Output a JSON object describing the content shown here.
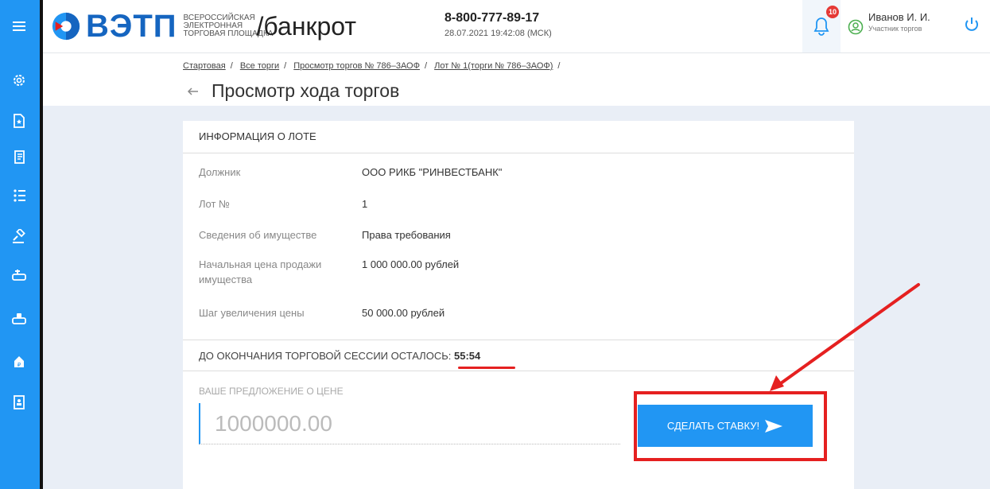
{
  "brand": {
    "logo_text": "ВЭТП",
    "sub_line1": "ВСЕРОССИЙСКАЯ",
    "sub_line2": "ЭЛЕКТРОННАЯ",
    "sub_line3": "ТОРГОВАЯ ПЛОЩАДКА",
    "section": "/банкрот",
    "colors": {
      "primary": "#2196f3",
      "brand": "#1565c0",
      "accent_red": "#e52020"
    }
  },
  "header": {
    "phone": "8-800-777-89-17",
    "datetime": "28.07.2021 19:42:08 (МСК)",
    "notifications_count": "10",
    "user_name": "Иванов И. И.",
    "user_role": "Участник торгов"
  },
  "sidebar": {
    "icons": [
      "menu-icon",
      "settings-icon",
      "document-star-icon",
      "contract-icon",
      "list-stars-icon",
      "auction-hammer-icon",
      "add-doc-icon",
      "stamp-icon",
      "money-bag-icon",
      "address-book-icon"
    ]
  },
  "breadcrumb": {
    "items": [
      "Стартовая",
      "Все торги",
      "Просмотр торгов № 786–3АОФ",
      "Лот № 1(торги № 786–3АОФ)"
    ]
  },
  "page": {
    "title": "Просмотр хода торгов"
  },
  "lot": {
    "header": "ИНФОРМАЦИЯ О ЛОТЕ",
    "fields": [
      {
        "label": "Должник",
        "value": "ООО РИКБ \"РИНВЕСТБАНК\""
      },
      {
        "label": "Лот №",
        "value": "1"
      },
      {
        "label": "Сведения об имуществе",
        "value": "Права требования"
      },
      {
        "label": "Начальная цена продажи имущества",
        "value": "1 000 000.00 рублей"
      },
      {
        "label": "Шаг увеличения цены",
        "value": "50 000.00 рублей"
      }
    ]
  },
  "session": {
    "label": "ДО ОКОНЧАНИЯ ТОРГОВОЙ СЕССИИ ОСТАЛОСЬ:",
    "time_left": "55:54"
  },
  "offer": {
    "label": "ВАШЕ ПРЕДЛОЖЕНИЕ О ЦЕНЕ",
    "placeholder": "1000000.00",
    "button_label": "СДЕЛАТЬ СТАВКУ!"
  }
}
